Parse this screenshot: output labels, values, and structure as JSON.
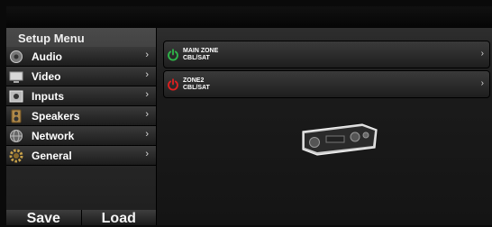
{
  "sidebar": {
    "title": "Setup Menu",
    "items": [
      {
        "label": "Audio",
        "icon": "speaker-icon"
      },
      {
        "label": "Video",
        "icon": "monitor-icon"
      },
      {
        "label": "Inputs",
        "icon": "input-icon"
      },
      {
        "label": "Speakers",
        "icon": "speaker-box-icon"
      },
      {
        "label": "Network",
        "icon": "globe-icon"
      },
      {
        "label": "General",
        "icon": "gear-icon"
      }
    ],
    "chevron": "›",
    "save_label": "Save",
    "load_label": "Load"
  },
  "zones": [
    {
      "name": "MAIN ZONE",
      "source": "CBL/SAT",
      "power_color": "#2fb84a"
    },
    {
      "name": "ZONE2",
      "source": "CBL/SAT",
      "power_color": "#e02020"
    }
  ]
}
